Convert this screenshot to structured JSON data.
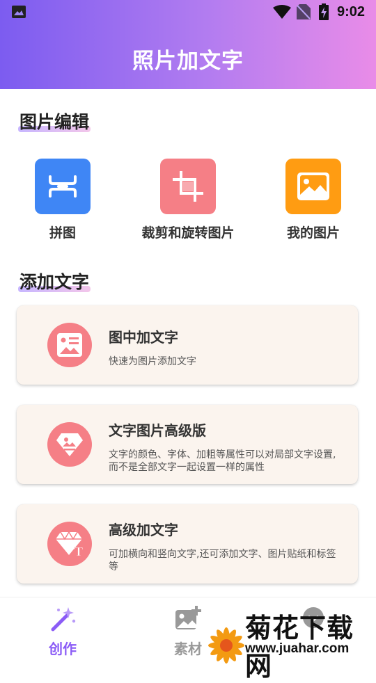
{
  "status_bar": {
    "time": "9:02"
  },
  "header": {
    "title": "照片加文字"
  },
  "sections": {
    "edit": {
      "title": "图片编辑"
    },
    "text": {
      "title": "添加文字"
    }
  },
  "tools": [
    {
      "label": "拼图",
      "icon": "collage-icon",
      "color": "#3f86f5"
    },
    {
      "label": "裁剪和旋转图片",
      "icon": "crop-icon",
      "color": "#f57f86"
    },
    {
      "label": "我的图片",
      "icon": "image-icon",
      "color": "#ff9c12"
    }
  ],
  "cards": [
    {
      "title": "图中加文字",
      "desc": "快速为图片添加文字",
      "icon": "picture-text-icon"
    },
    {
      "title": "文字图片高级版",
      "desc": "文字的颜色、字体、加粗等属性可以对局部文字设置,而不是全部文字一起设置一样的属性",
      "icon": "diamond-image-icon"
    },
    {
      "title": "高级加文字",
      "desc": "可加横向和竖向文字,还可添加文字、图片贴纸和标签等",
      "icon": "diamond-text-icon"
    }
  ],
  "tabs": [
    {
      "label": "创作",
      "icon": "magic-wand-icon",
      "active": true
    },
    {
      "label": "素材",
      "icon": "image-add-icon",
      "active": false
    },
    {
      "label": "",
      "icon": "profile-icon",
      "active": false
    }
  ],
  "watermark": {
    "name": "菊花下载网",
    "url": "www.juahar.com"
  },
  "colors": {
    "accent": "#8b5cf6",
    "card_bg": "#fbf4ee",
    "badge": "#f57f86"
  }
}
